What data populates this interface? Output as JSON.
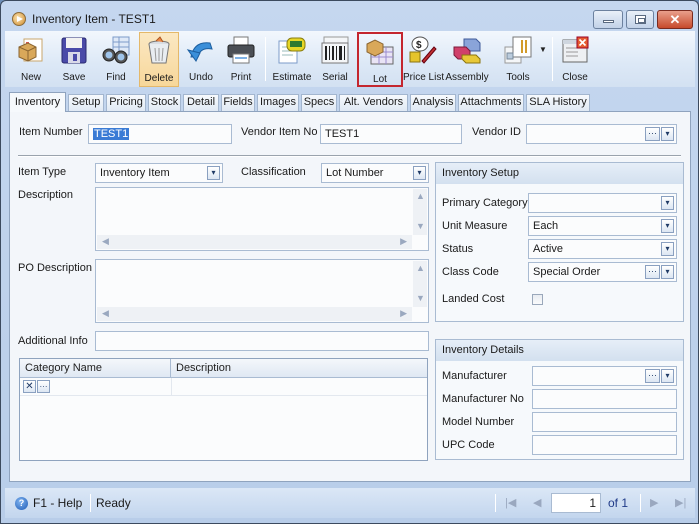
{
  "window": {
    "title": "Inventory Item - TEST1",
    "controls": {
      "minimize": "minimize",
      "maximize": "maximize",
      "close": "✕"
    }
  },
  "toolbar": {
    "buttons": [
      {
        "id": "new",
        "label": "New",
        "icon": "new-item-icon"
      },
      {
        "id": "save",
        "label": "Save",
        "icon": "floppy-disk-icon"
      },
      {
        "id": "find",
        "label": "Find",
        "icon": "binoculars-icon"
      },
      {
        "id": "delete",
        "label": "Delete",
        "icon": "trash-bin-icon",
        "state": "hover"
      },
      {
        "id": "undo",
        "label": "Undo",
        "icon": "undo-arrow-icon"
      },
      {
        "id": "print",
        "label": "Print",
        "icon": "printer-icon"
      },
      {
        "id": "estimate",
        "label": "Estimate",
        "icon": "estimate-icon"
      },
      {
        "id": "serial",
        "label": "Serial",
        "icon": "barcode-icon"
      },
      {
        "id": "lot",
        "label": "Lot",
        "icon": "lot-box-icon",
        "state": "highlighted"
      },
      {
        "id": "price_list",
        "label": "Price List",
        "icon": "price-list-icon"
      },
      {
        "id": "assembly",
        "label": "Assembly",
        "icon": "assembly-blocks-icon"
      },
      {
        "id": "tools",
        "label": "Tools",
        "icon": "tools-icon"
      },
      {
        "id": "close",
        "label": "Close",
        "icon": "close-window-icon"
      }
    ],
    "tools_dropdown": "▼"
  },
  "tabs": [
    {
      "label": "Inventory",
      "active": true
    },
    {
      "label": "Setup"
    },
    {
      "label": "Pricing"
    },
    {
      "label": "Stock"
    },
    {
      "label": "Detail"
    },
    {
      "label": "Fields"
    },
    {
      "label": "Images"
    },
    {
      "label": "Specs"
    },
    {
      "label": "Alt. Vendors"
    },
    {
      "label": "Analysis"
    },
    {
      "label": "Attachments"
    },
    {
      "label": "SLA History"
    }
  ],
  "form": {
    "item_number": {
      "label": "Item Number",
      "value": "TEST1"
    },
    "vendor_item_no": {
      "label": "Vendor Item No",
      "value": "TEST1"
    },
    "vendor_id": {
      "label": "Vendor ID",
      "value": ""
    },
    "item_type": {
      "label": "Item Type",
      "value": "Inventory Item"
    },
    "classification": {
      "label": "Classification",
      "value": "Lot Number"
    },
    "description": {
      "label": "Description",
      "value": ""
    },
    "po_description": {
      "label": "PO Description",
      "value": ""
    },
    "additional_info": {
      "label": "Additional Info",
      "value": ""
    }
  },
  "category_grid": {
    "columns": [
      "Category Name",
      "Description"
    ],
    "rows": [
      {
        "category_name": "",
        "description": ""
      }
    ],
    "row_buttons": {
      "remove": "✕",
      "browse": "···"
    }
  },
  "inventory_setup": {
    "title": "Inventory Setup",
    "primary_category": {
      "label": "Primary Category",
      "value": ""
    },
    "unit_measure": {
      "label": "Unit Measure",
      "value": "Each"
    },
    "status": {
      "label": "Status",
      "value": "Active"
    },
    "class_code": {
      "label": "Class Code",
      "value": "Special Order"
    },
    "landed_cost": {
      "label": "Landed Cost",
      "checked": false
    }
  },
  "inventory_details": {
    "title": "Inventory Details",
    "manufacturer": {
      "label": "Manufacturer",
      "value": ""
    },
    "manufacturer_no": {
      "label": "Manufacturer No",
      "value": ""
    },
    "model_number": {
      "label": "Model Number",
      "value": ""
    },
    "upc_code": {
      "label": "UPC Code",
      "value": ""
    }
  },
  "statusbar": {
    "help": "F1 - Help",
    "status": "Ready",
    "page": "1",
    "of_label": "of 1"
  },
  "glyphs": {
    "dropdown": "▾",
    "ellipsis": "···",
    "up": "▲",
    "down": "▼",
    "left": "◀",
    "right": "▶",
    "first": "|◀",
    "prev": "◀",
    "next": "▶",
    "last": "▶|"
  }
}
